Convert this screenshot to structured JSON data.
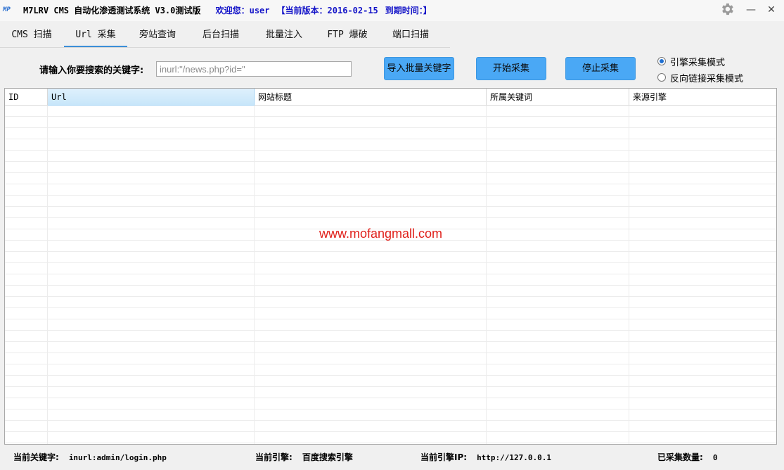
{
  "window": {
    "logo": "MP",
    "app_title": "M7LRV CMS 自动化渗透测试系统 V3.0测试版",
    "welcome": "欢迎您：user",
    "version": "【当前版本：2016-02-15",
    "expire": "到期时间：】"
  },
  "tabs": [
    {
      "label": "CMS 扫描"
    },
    {
      "label": "Url 采集"
    },
    {
      "label": "旁站查询"
    },
    {
      "label": "后台扫描"
    },
    {
      "label": "批量注入"
    },
    {
      "label": "FTP 爆破"
    },
    {
      "label": "端口扫描"
    }
  ],
  "search": {
    "label": "请输入你要搜索的关键字:",
    "placeholder": "inurl:\"/news.php?id=\""
  },
  "buttons": {
    "import": "导入批量关键字",
    "start": "开始采集",
    "stop": "停止采集"
  },
  "modes": [
    {
      "label": "引擎采集模式",
      "checked": true
    },
    {
      "label": "反向链接采集模式",
      "checked": false
    }
  ],
  "table": {
    "columns": [
      "ID",
      "Url",
      "网站标题",
      "所属关键词",
      "来源引擎"
    ]
  },
  "watermark": "www.mofangmall.com",
  "status": {
    "keyword_label": "当前关键字:",
    "keyword_value": "inurl:admin/login.php",
    "engine_label": "当前引擎:",
    "engine_value": "百度搜索引擎",
    "engine_ip_label": "当前引擎IP:",
    "engine_ip_value": "http://127.0.0.1",
    "count_label": "已采集数量:",
    "count_value": "0"
  }
}
